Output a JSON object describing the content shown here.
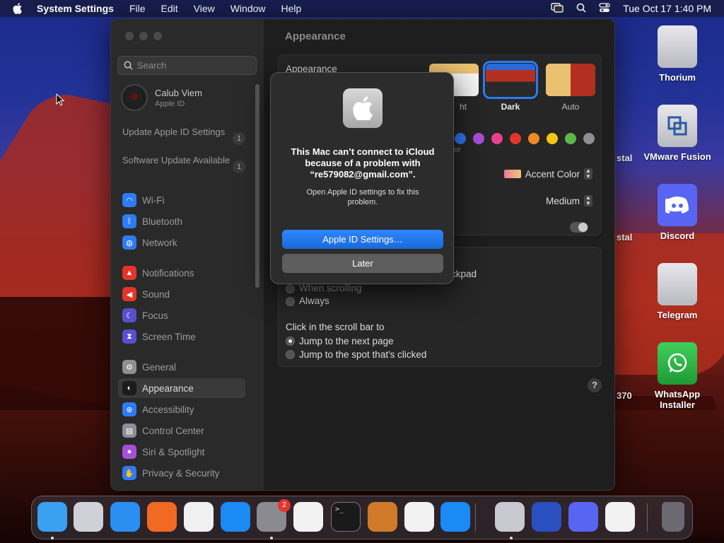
{
  "menubar": {
    "app_name": "System Settings",
    "menus": [
      "File",
      "Edit",
      "View",
      "Window",
      "Help"
    ],
    "datetime": "Tue Oct 17  1:40 PM"
  },
  "window": {
    "search_placeholder": "Search",
    "user": {
      "name": "Calub Viem",
      "subtitle": "Apple ID"
    },
    "updates": [
      {
        "label": "Update Apple ID Settings",
        "count": "1"
      },
      {
        "label": "Software Update Available",
        "count": "1"
      }
    ],
    "sidebar": [
      {
        "label": "Wi-Fi",
        "icon": "wifi-icon",
        "color": "#2f7bf5",
        "glyph": "◠"
      },
      {
        "label": "Bluetooth",
        "icon": "bluetooth-icon",
        "color": "#2f7bf5",
        "glyph": "ᛒ"
      },
      {
        "label": "Network",
        "icon": "globe-icon",
        "color": "#2f7bf5",
        "glyph": "◍"
      },
      {
        "label": "Notifications",
        "icon": "bell-icon",
        "color": "#e5352b",
        "glyph": "▲"
      },
      {
        "label": "Sound",
        "icon": "speaker-icon",
        "color": "#e5352b",
        "glyph": "◀"
      },
      {
        "label": "Focus",
        "icon": "moon-icon",
        "color": "#5a4fcf",
        "glyph": "☾"
      },
      {
        "label": "Screen Time",
        "icon": "hourglass-icon",
        "color": "#5a4fcf",
        "glyph": "⧗"
      },
      {
        "label": "General",
        "icon": "gear-icon",
        "color": "#8e8e93",
        "glyph": "⚙"
      },
      {
        "label": "Appearance",
        "icon": "appearance-icon",
        "color": "#1c1c1c",
        "glyph": "◐"
      },
      {
        "label": "Accessibility",
        "icon": "accessibility-icon",
        "color": "#2f7bf5",
        "glyph": "⊕"
      },
      {
        "label": "Control Center",
        "icon": "control-center-icon",
        "color": "#8e8e93",
        "glyph": "▤"
      },
      {
        "label": "Siri & Spotlight",
        "icon": "siri-icon",
        "color": "#a64fd8",
        "glyph": "●"
      },
      {
        "label": "Privacy & Security",
        "icon": "hand-icon",
        "color": "#2f7bf5",
        "glyph": "✋"
      }
    ],
    "selected_item": "Appearance",
    "main": {
      "title": "Appearance",
      "appearance_label": "Appearance",
      "themes": [
        {
          "label": "Light",
          "visible_label": "ht",
          "selected": false
        },
        {
          "label": "Dark",
          "visible_label": "Dark",
          "selected": true
        },
        {
          "label": "Auto",
          "visible_label": "Auto",
          "selected": false
        }
      ],
      "accent_colors": [
        "#2f7bf5",
        "#a64fd8",
        "#e8408f",
        "#e5352b",
        "#f08a24",
        "#f5c518",
        "#5cb84a",
        "#8e8e93"
      ],
      "highlight_partial": "or",
      "highlight_value": "Accent Color",
      "sidebar_icon_size": "Medium",
      "scroll_partial": "ckpad",
      "scroll_options": [
        "When scrolling",
        "Always"
      ],
      "click_label": "Click in the scroll bar to",
      "click_options": [
        "Jump to the next page",
        "Jump to the spot that's clicked"
      ],
      "click_selected": 0
    }
  },
  "dialog": {
    "title": "This Mac can’t connect to iCloud because of a problem with “re579082@gmail.com”.",
    "body": "Open Apple ID settings to fix this problem.",
    "primary": "Apple ID Settings…",
    "secondary": "Later"
  },
  "desktop": {
    "icons": [
      {
        "label": "Thorium",
        "icon": "drive-icon"
      },
      {
        "label": "VMware Fusion",
        "icon": "vmware-drive-icon"
      },
      {
        "label": "Discord",
        "icon": "discord-icon"
      },
      {
        "label": "Telegram",
        "icon": "drive-icon"
      },
      {
        "label": "WhatsApp Installer",
        "icon": "whatsapp-drive-icon"
      }
    ],
    "partial_labels": [
      "stal",
      "stal",
      "370"
    ]
  },
  "dock": {
    "apps": [
      {
        "name": "Finder",
        "icon": "finder-icon",
        "color": "#3aa0f0"
      },
      {
        "name": "Launchpad",
        "icon": "launchpad-icon",
        "color": "#d0d0d8"
      },
      {
        "name": "Safari",
        "icon": "safari-icon",
        "color": "#2a8ff0"
      },
      {
        "name": "Firefox",
        "icon": "firefox-icon",
        "color": "#f06a24"
      },
      {
        "name": "Chrome",
        "icon": "chrome-icon",
        "color": "#f0f0f0"
      },
      {
        "name": "App Store",
        "icon": "app-store-icon",
        "color": "#1a8af5"
      },
      {
        "name": "System Settings",
        "icon": "settings-icon",
        "color": "#8a8a90",
        "badge": "2"
      },
      {
        "name": "TextEdit",
        "icon": "textedit-icon",
        "color": "#f2f2f2"
      },
      {
        "name": "Terminal",
        "icon": "terminal-icon",
        "color": "#1a1a1a"
      },
      {
        "name": "GarageBand",
        "icon": "guitar-icon",
        "color": "#d07a2a"
      },
      {
        "name": "VS Code",
        "icon": "vscode-icon",
        "color": "#f2f2f2"
      },
      {
        "name": "VMware",
        "icon": "vmware-icon",
        "color": "#1a8af5"
      },
      {
        "name": "Installer",
        "icon": "installer-icon",
        "color": "#c8c8d0"
      },
      {
        "name": "Screen App",
        "icon": "screen-icon",
        "color": "#2a4fc0"
      },
      {
        "name": "Discord",
        "icon": "discord-icon",
        "color": "#5865f2"
      },
      {
        "name": "VMware Fusion",
        "icon": "vmware-fusion-icon",
        "color": "#f2f2f2"
      },
      {
        "name": "Trash",
        "icon": "trash-icon",
        "color": "#6a6a70"
      }
    ]
  }
}
